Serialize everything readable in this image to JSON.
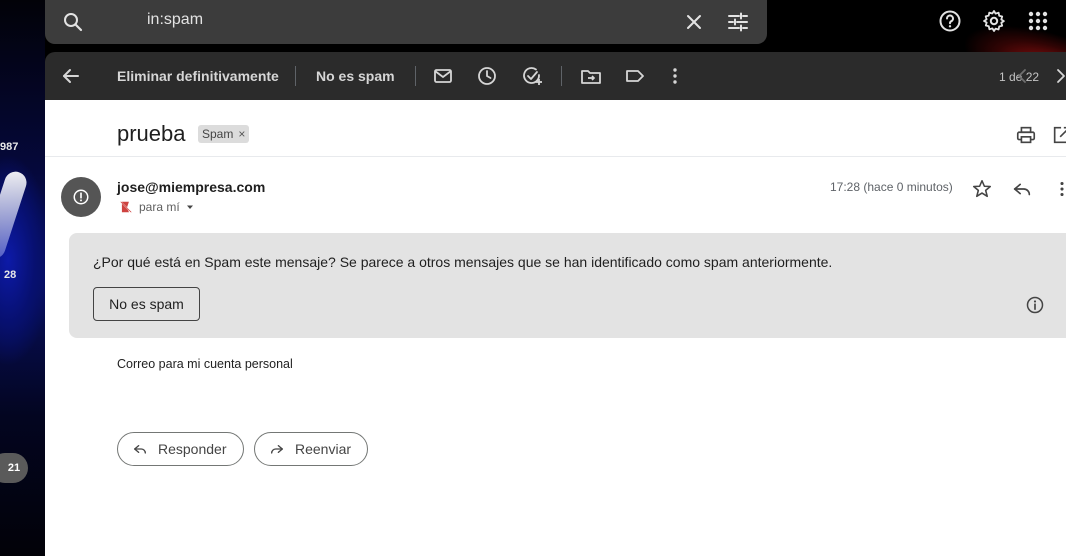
{
  "search": {
    "query": "in:spam"
  },
  "wallpaper": {
    "numbers": [
      "987",
      "28",
      "21"
    ]
  },
  "toolbar": {
    "delete_forever_label": "Eliminar definitivamente",
    "not_spam_label": "No es spam",
    "counter": "1 de 22"
  },
  "message": {
    "subject": "prueba",
    "label_chip": "Spam",
    "chip_close": "×",
    "sender": "jose@miempresa.com",
    "recipient": "para mí",
    "time": "17:28 (hace 0 minutos)",
    "warning_question": "¿Por qué está en Spam este mensaje?",
    "warning_reason": " Se parece a otros mensajes que se han identificado como spam anteriormente.",
    "warning_button": "No es spam",
    "body": "Correo para mi cuenta personal"
  },
  "actions": {
    "reply_label": "Responder",
    "forward_label": "Reenviar"
  },
  "colors": {
    "toolbar_bg": "#2b2b2b",
    "search_bg": "#3c3c3c",
    "warning_bg": "#e3e3e3",
    "spam_icon_red": "#c5221f"
  }
}
